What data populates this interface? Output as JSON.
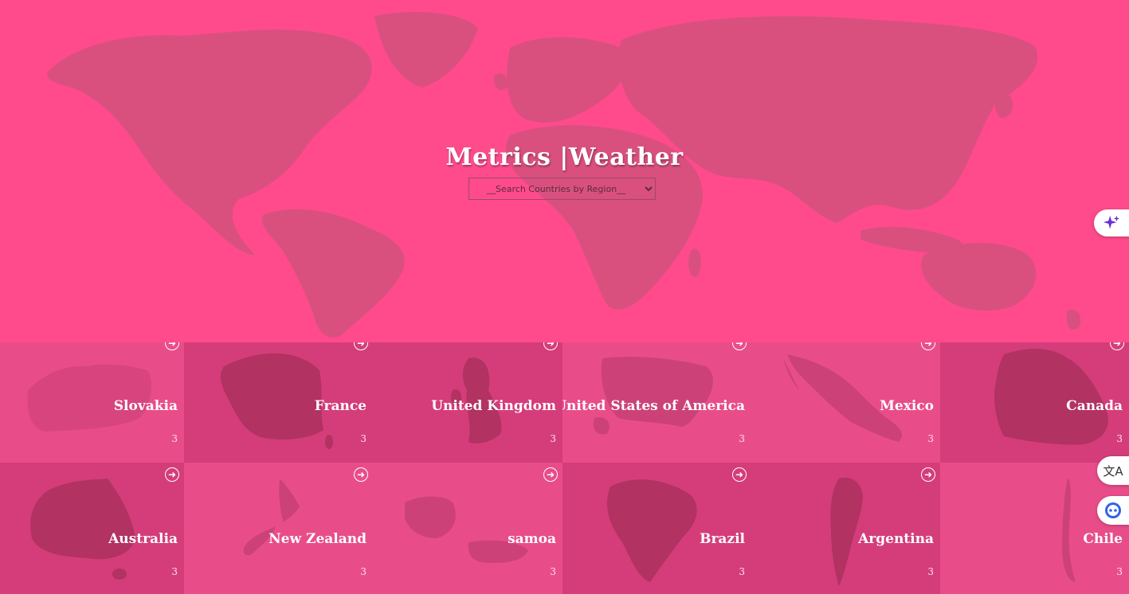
{
  "hero": {
    "title": "Metrics |Weather",
    "select": {
      "selected": "__Search Countries by Region__",
      "options": [
        "__Search Countries by Region__"
      ]
    }
  },
  "countries": [
    {
      "name": "Slovakia",
      "count": "3",
      "bg": "#e84d8a",
      "shape": "#d8457e"
    },
    {
      "name": "France",
      "count": "3",
      "bg": "#d43d7a",
      "shape": "#b23262"
    },
    {
      "name": "United Kingdom",
      "count": "3",
      "bg": "#d43d7a",
      "shape": "#b23262"
    },
    {
      "name": "United States of America",
      "count": "3",
      "bg": "#e84d8a",
      "shape": "#cc4278"
    },
    {
      "name": "Mexico",
      "count": "3",
      "bg": "#e84d8a",
      "shape": "#cc4278"
    },
    {
      "name": "Canada",
      "count": "3",
      "bg": "#d43d7a",
      "shape": "#b23262"
    },
    {
      "name": "Australia",
      "count": "3",
      "bg": "#d43d7a",
      "shape": "#b23262"
    },
    {
      "name": "New Zealand",
      "count": "3",
      "bg": "#e84d8a",
      "shape": "#cc4278"
    },
    {
      "name": "samoa",
      "count": "3",
      "bg": "#e84d8a",
      "shape": "#cc4278"
    },
    {
      "name": "Brazil",
      "count": "3",
      "bg": "#d43d7a",
      "shape": "#b23262"
    },
    {
      "name": "Argentina",
      "count": "3",
      "bg": "#d43d7a",
      "shape": "#b23262"
    },
    {
      "name": "Chile",
      "count": "3",
      "bg": "#e84d8a",
      "shape": "#cc4278"
    }
  ],
  "icons": {
    "card_arrow": "arrow-right-circle-icon",
    "ai": "sparkle-icon",
    "translate": "translate-icon",
    "assistant": "assistant-icon"
  }
}
